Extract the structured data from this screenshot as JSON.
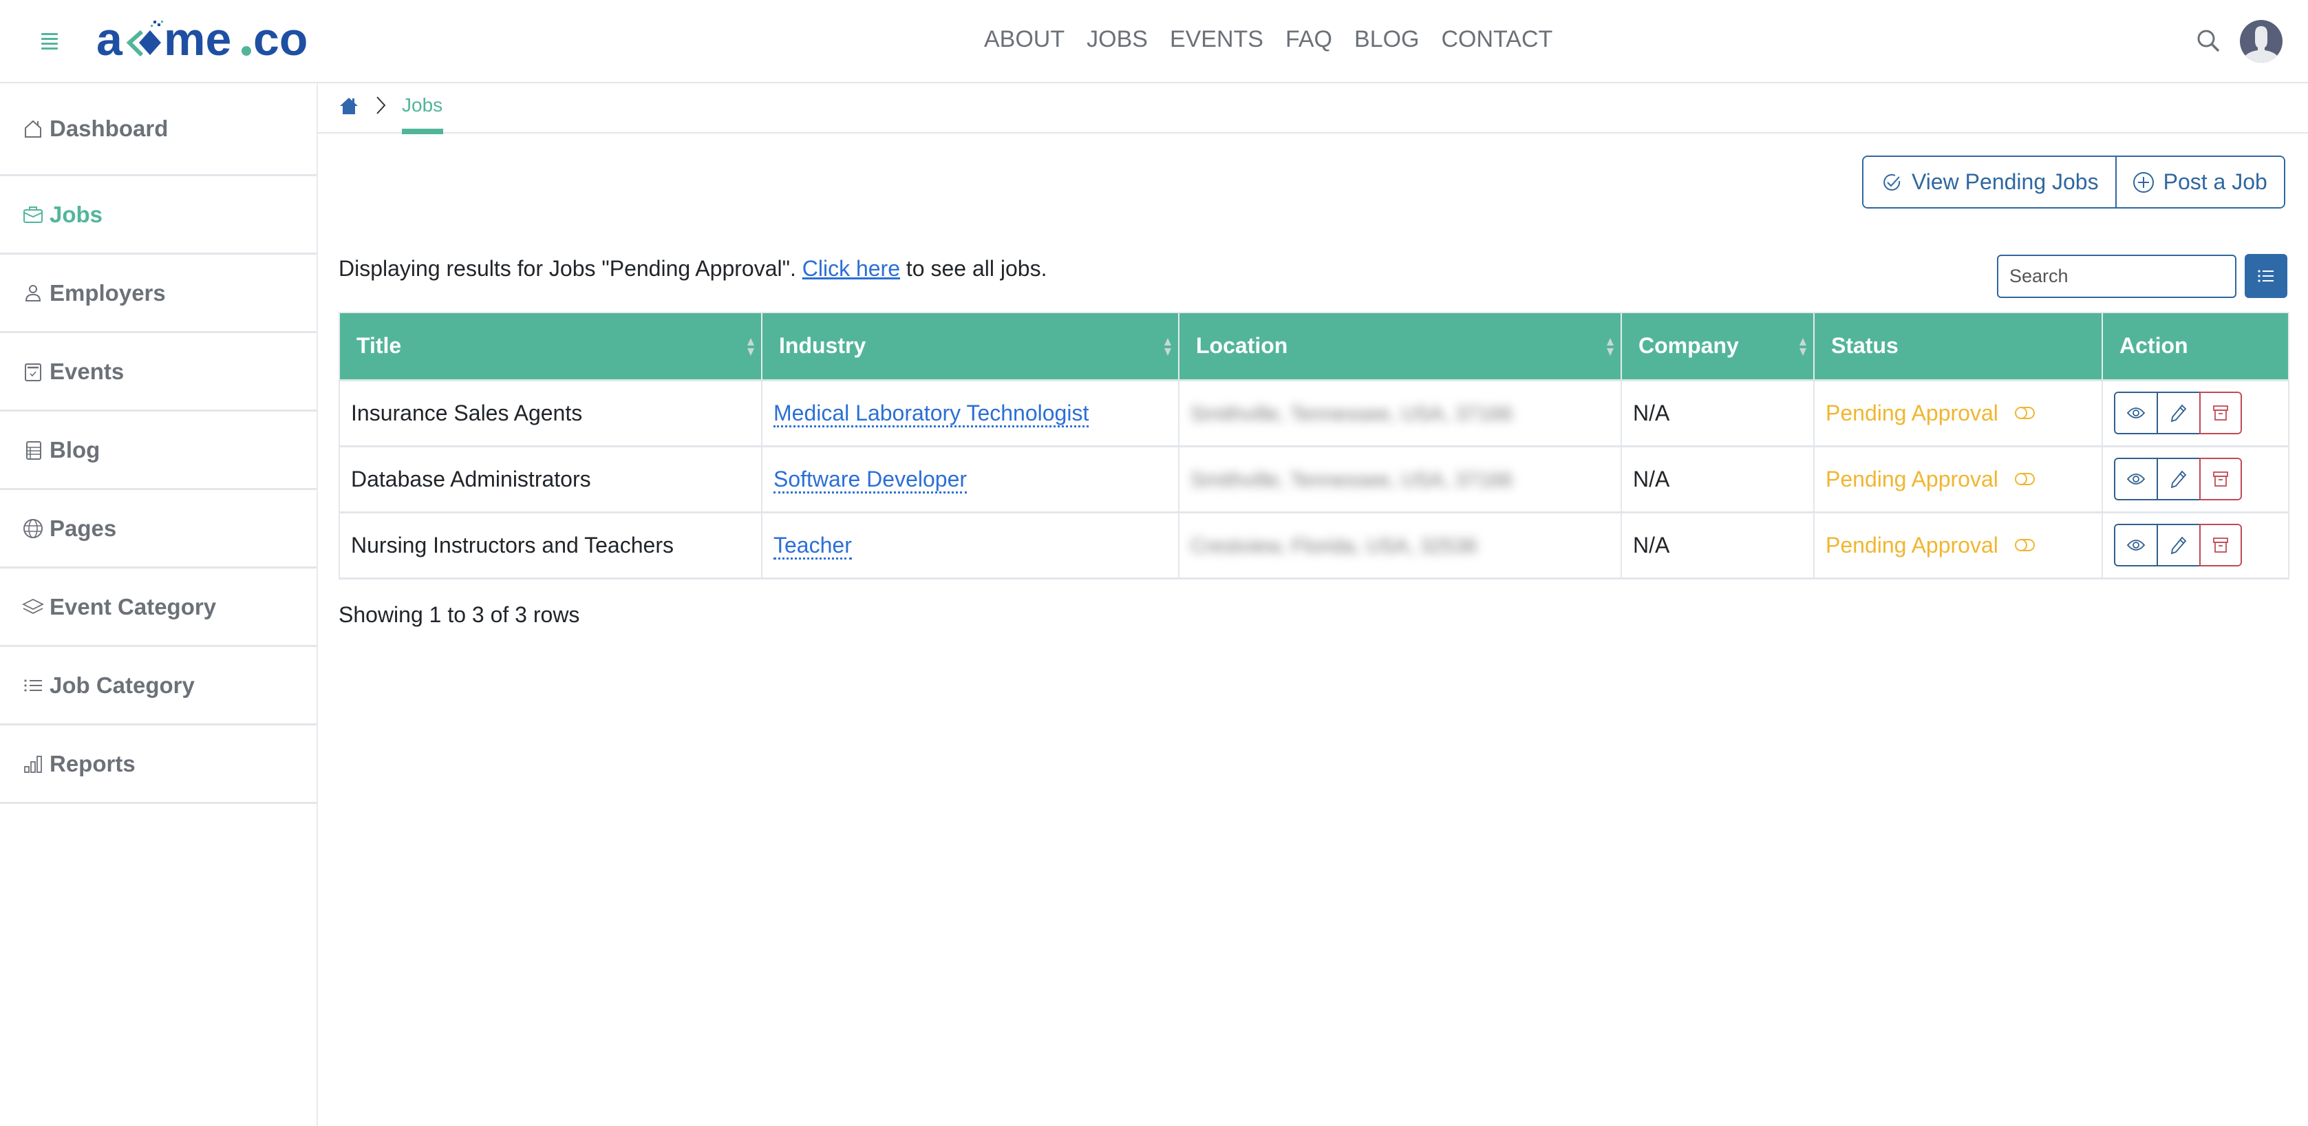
{
  "header": {
    "logo_text": "acme.co",
    "nav": [
      "ABOUT",
      "JOBS",
      "EVENTS",
      "FAQ",
      "BLOG",
      "CONTACT"
    ]
  },
  "sidebar": {
    "items": [
      {
        "label": "Dashboard",
        "icon": "home-icon",
        "active": false
      },
      {
        "label": "Jobs",
        "icon": "briefcase-icon",
        "active": true
      },
      {
        "label": "Employers",
        "icon": "person-icon",
        "active": false
      },
      {
        "label": "Events",
        "icon": "calendar-check-icon",
        "active": false
      },
      {
        "label": "Blog",
        "icon": "document-icon",
        "active": false
      },
      {
        "label": "Pages",
        "icon": "globe-icon",
        "active": false
      },
      {
        "label": "Event Category",
        "icon": "layers-icon",
        "active": false
      },
      {
        "label": "Job Category",
        "icon": "list-icon",
        "active": false
      },
      {
        "label": "Reports",
        "icon": "bar-chart-icon",
        "active": false
      }
    ]
  },
  "breadcrumb": {
    "home_icon": "home-icon",
    "current": "Jobs"
  },
  "toolbar": {
    "view_pending_label": "View Pending Jobs",
    "post_job_label": "Post a Job"
  },
  "description": {
    "prefix": "Displaying results for Jobs \"Pending Approval\". ",
    "link": "Click here",
    "suffix": " to see all jobs."
  },
  "search": {
    "placeholder": "Search",
    "value": ""
  },
  "table": {
    "columns": [
      {
        "label": "Title",
        "sortable": true
      },
      {
        "label": "Industry",
        "sortable": true
      },
      {
        "label": "Location",
        "sortable": true
      },
      {
        "label": "Company",
        "sortable": true
      },
      {
        "label": "Status",
        "sortable": false
      },
      {
        "label": "Action",
        "sortable": false
      }
    ],
    "rows": [
      {
        "title": "Insurance Sales Agents",
        "industry": "Medical Laboratory Technologist",
        "location": "Smithville, Tennessee, USA, 37166",
        "company": "N/A",
        "status": "Pending Approval"
      },
      {
        "title": "Database Administrators",
        "industry": "Software Developer",
        "location": "Smithville, Tennessee, USA, 37166",
        "company": "N/A",
        "status": "Pending Approval"
      },
      {
        "title": "Nursing Instructors and Teachers",
        "industry": "Teacher",
        "location": "Crestview, Florida, USA, 32536",
        "company": "N/A",
        "status": "Pending Approval"
      }
    ],
    "location_blurred": true
  },
  "pagination": {
    "summary": "Showing 1 to 3 of 3 rows"
  },
  "colors": {
    "brand_green": "#52b59a",
    "brand_blue": "#1f4fa3",
    "button_blue": "#2f679f",
    "link_blue": "#2b6fd6",
    "status_pending": "#f0b630",
    "delete_red": "#c04a55",
    "muted_text": "#6c7178"
  }
}
